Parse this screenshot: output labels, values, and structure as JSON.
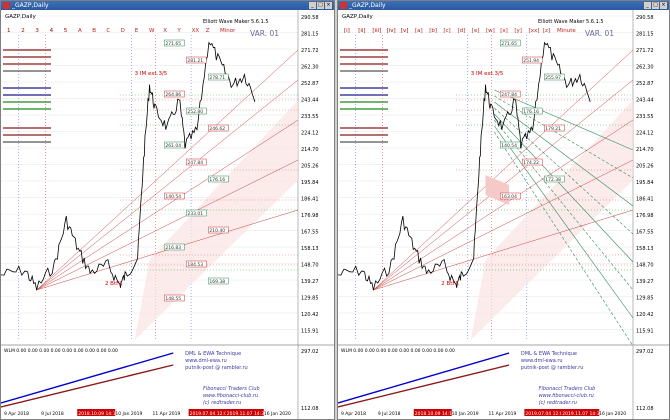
{
  "left": {
    "title": "_GAZP,Daily",
    "symbol": "GAZP,Daily",
    "indicator": "Elliott Wave Maker 5.6.1.5",
    "var_label": "VAR. 01",
    "timeframes": [
      "1",
      "2",
      "3",
      "4",
      "5",
      "A",
      "B",
      "C",
      "D",
      "E",
      "W",
      "X",
      "Y",
      "XX",
      "Z",
      "Minor"
    ],
    "prices": [
      "290.58",
      "281.15",
      "271.72",
      "262.30",
      "252.87",
      "243.44",
      "233.55",
      "224.12",
      "214.70",
      "205.26",
      "195.84",
      "186.41",
      "176.98",
      "167.55",
      "158.13",
      "148.70",
      "139.27",
      "129.85",
      "120.42",
      "115.91"
    ],
    "wave_labels": [
      "3 IM ext.3/5",
      "2 BtFL"
    ],
    "price_tags": [
      "271.65",
      "281.21",
      "278.71",
      "264.86",
      "252.80",
      "246.62",
      "261.04",
      "247.84",
      "176.16",
      "140.54",
      "233.01",
      "210.40",
      "216.83",
      "184.53",
      "169.38",
      "148.55"
    ]
  },
  "right": {
    "title": "_GAZP,Daily",
    "symbol": "GAZP,Daily",
    "indicator": "Elliott Wave Maker 5.6.1.5",
    "var_label": "VAR. 01",
    "timeframes": [
      "[i]",
      "[ii]",
      "[iii]",
      "[iv]",
      "[v]",
      "[a]",
      "[b]",
      "[c]",
      "[d]",
      "[e]",
      "[w]",
      "[x]",
      "[y]",
      "[xx]",
      "[z]",
      "Minute"
    ],
    "prices": [
      "290.58",
      "281.15",
      "271.72",
      "262.30",
      "252.87",
      "243.44",
      "233.55",
      "224.12",
      "214.70",
      "205.26",
      "195.84",
      "186.41",
      "176.98",
      "167.55",
      "158.13",
      "148.70",
      "139.27",
      "129.85",
      "120.42",
      "115.91"
    ],
    "wave_labels": [
      "3 IM ext.3/5",
      "2 BtFL"
    ],
    "price_tags": [
      "271.65",
      "251.94",
      "255.97",
      "247.84",
      "176.16",
      "179.21",
      "140.54",
      "174.22",
      "172.38",
      "163.04"
    ]
  },
  "sub": {
    "indicator_label": "WLM 0.00 0.00 0.00 0.00 0.00 0.00 0.00 0.00 0.00",
    "watermark_lines": [
      "DML & EWA Technique",
      "www.dml-ewa.ru",
      "putnik-post @ rambler.ru"
    ],
    "club_lines": [
      "Fibonacci Traders Club",
      "www.fibonacci-club.ru",
      "(c) redtrader.ru"
    ],
    "prices_left": [
      "297.02",
      "112.08"
    ],
    "dates": [
      "9 Apr 2018",
      "9 Jul 2018",
      "2018.10.09 14:15",
      "10 Jan 2019",
      "11 Apr 2019",
      "2019.07.04 12:00",
      "2019.11.07 14:30",
      "16 Jan 2020"
    ]
  },
  "colors": {
    "price_line": "#000000",
    "up_red": "#cc0000",
    "fib_green": "#2e8b57",
    "channel_pink": "#f2c4c4",
    "blue_line": "#0000cc"
  }
}
